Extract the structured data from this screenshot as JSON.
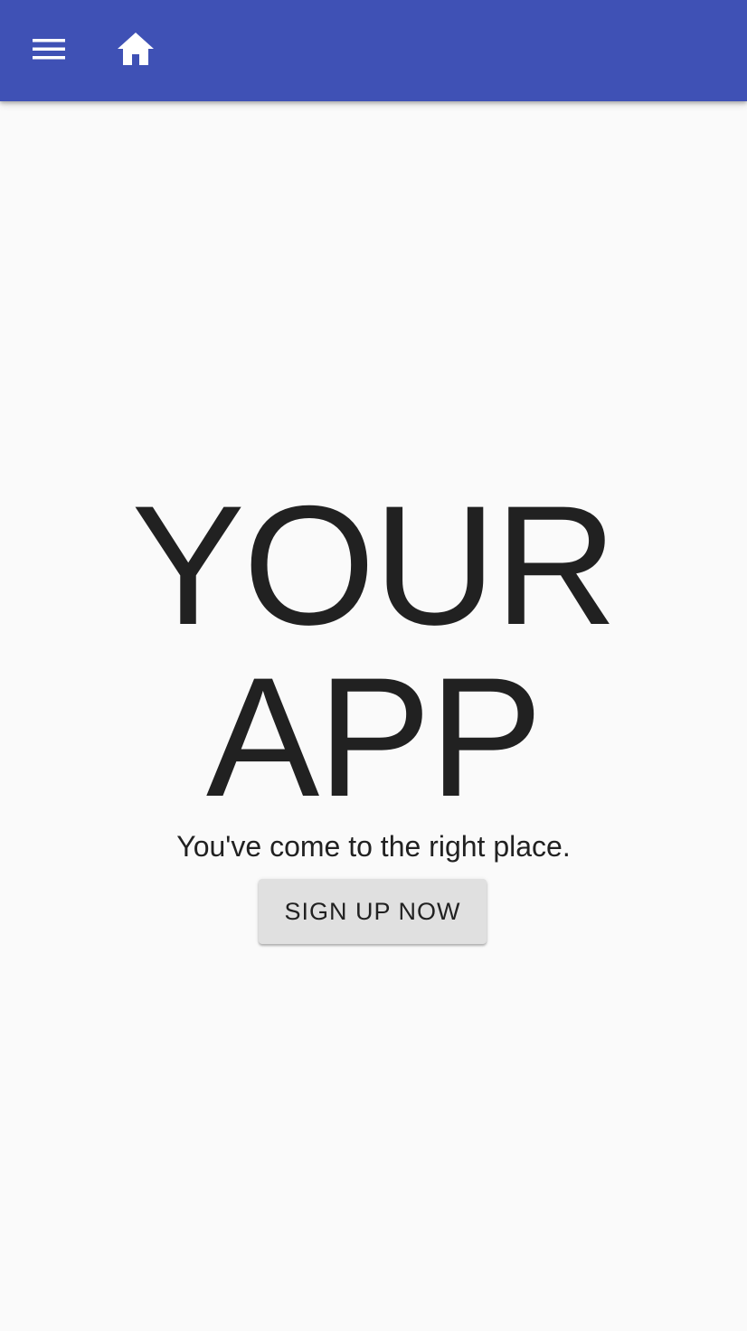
{
  "app_bar": {
    "background": "#3f51b5",
    "menu_icon": "menu-icon",
    "home_icon": "home-icon"
  },
  "hero": {
    "title_line1": "YOUR",
    "title_line2": "APP",
    "subtitle": "You've come to the right place.",
    "cta_label": "SIGN UP NOW"
  }
}
